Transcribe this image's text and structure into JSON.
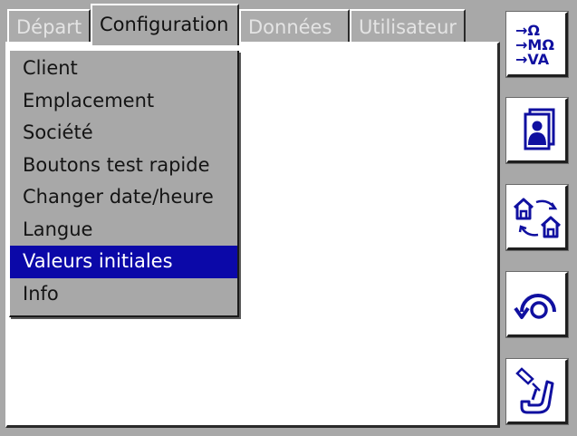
{
  "tabs": [
    {
      "label": "Départ",
      "active": false
    },
    {
      "label": "Configuration",
      "active": true
    },
    {
      "label": "Données",
      "active": false
    },
    {
      "label": "Utilisateur",
      "active": false
    }
  ],
  "menu": {
    "items": [
      {
        "label": "Client"
      },
      {
        "label": "Emplacement"
      },
      {
        "label": "Société"
      },
      {
        "label": "Boutons test rapide"
      },
      {
        "label": "Changer date/heure"
      },
      {
        "label": "Langue"
      },
      {
        "label": "Valeurs initiales",
        "selected": true
      },
      {
        "label": "Info"
      }
    ]
  },
  "side_buttons": {
    "measure": {
      "lines": [
        "→Ω",
        "→MΩ",
        "→VA"
      ],
      "icon": "measurement-units-icon"
    },
    "profile": {
      "icon": "user-profile-icon"
    },
    "transfer": {
      "icon": "house-transfer-icon"
    },
    "rotate": {
      "icon": "rotate-arrow-icon"
    },
    "probe": {
      "icon": "test-probe-icon"
    }
  },
  "colors": {
    "selection": "#0b08a8",
    "icon_blue": "#1010a0",
    "background": "#a8a8a8"
  }
}
